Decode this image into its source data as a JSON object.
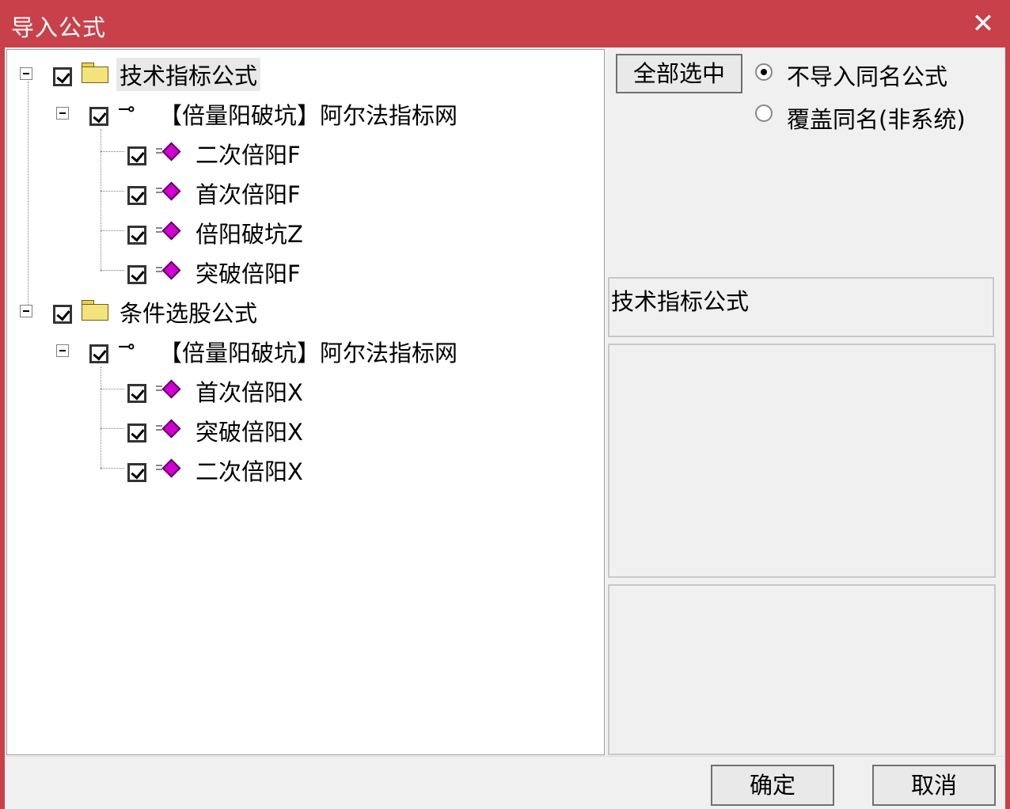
{
  "window": {
    "title": "导入公式",
    "close_glyph": "✕"
  },
  "tree": {
    "groups": [
      {
        "label": "技术指标公式",
        "package": "【倍量阳破坑】阿尔法指标网",
        "items": [
          "二次倍阳F",
          "首次倍阳F",
          "倍阳破坑Z",
          "突破倍阳F"
        ]
      },
      {
        "label": "条件选股公式",
        "package": "【倍量阳破坑】阿尔法指标网",
        "items": [
          "首次倍阳X",
          "突破倍阳X",
          "二次倍阳X"
        ]
      }
    ]
  },
  "options": {
    "select_all_label": "全部选中",
    "radio_no_import_label": "不导入同名公式",
    "radio_overwrite_label": "覆盖同名(非系统)",
    "selected": "no_import"
  },
  "info": {
    "category_text": "技术指标公式"
  },
  "footer": {
    "ok_label": "确定",
    "cancel_label": "取消"
  },
  "colors": {
    "titlebar": "#c8414a",
    "formula_icon": "#d200d2"
  },
  "icons": {
    "folder": "folder-icon",
    "package": "key-icon",
    "formula": "formula-gem-icon",
    "expander": "collapse-box-icon"
  }
}
